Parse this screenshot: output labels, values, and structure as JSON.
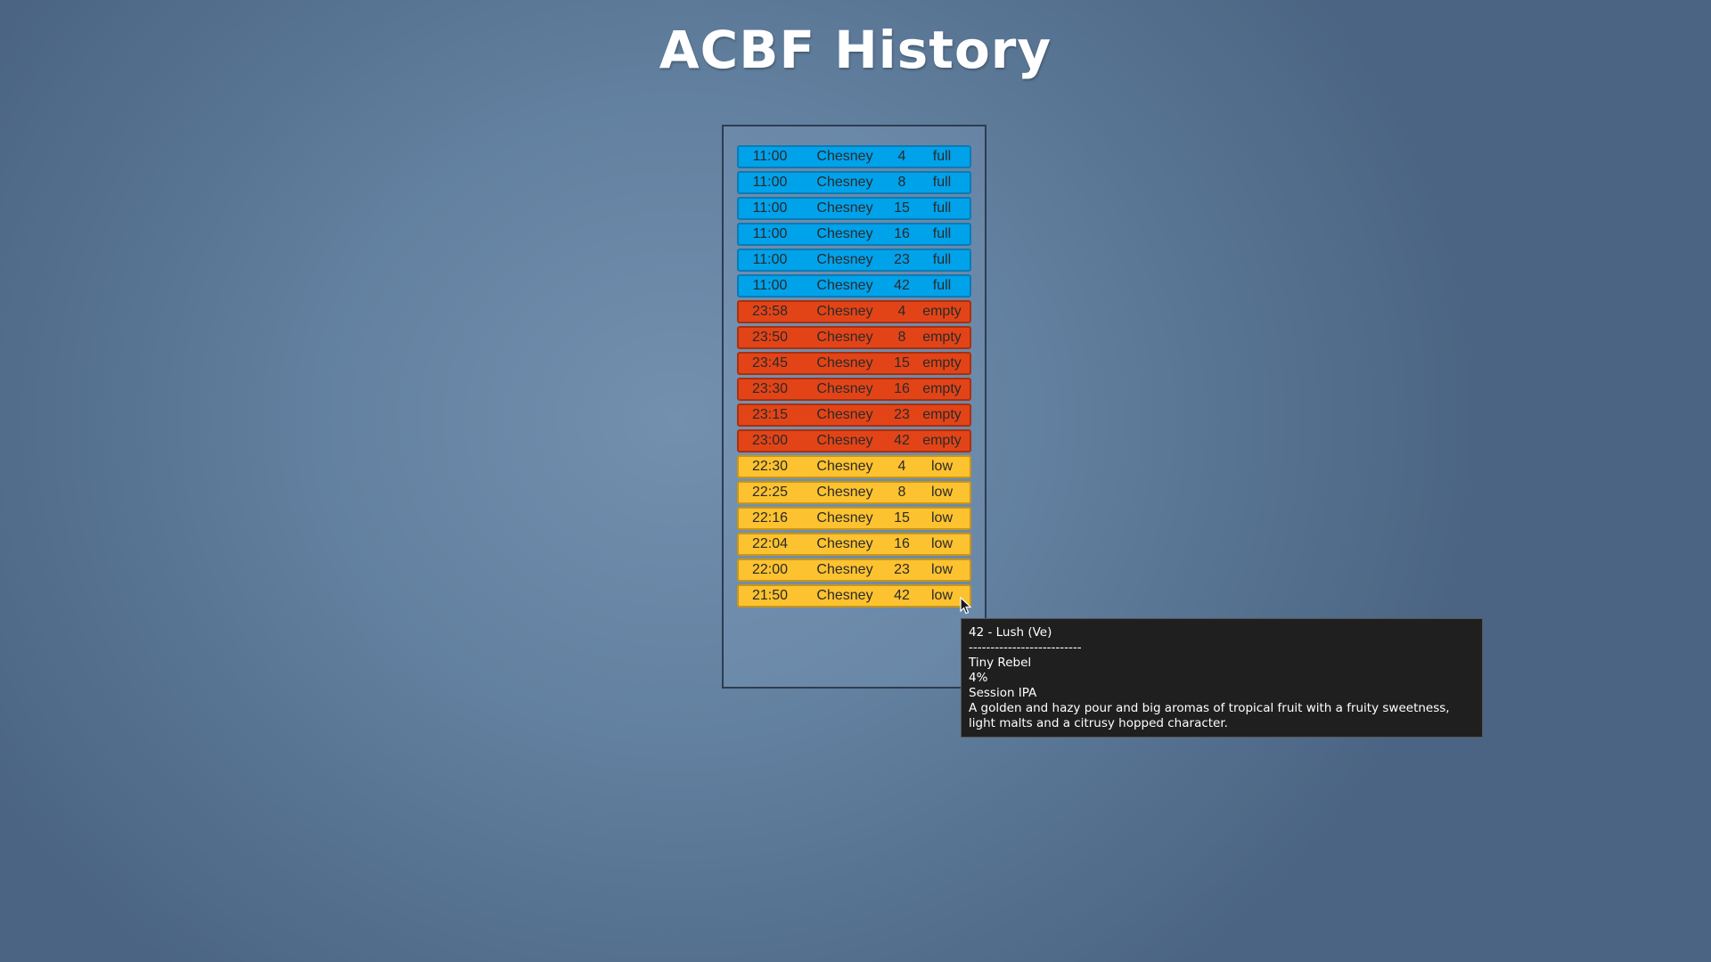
{
  "title": "ACBF History",
  "colors": {
    "full": "#00a2ea",
    "empty": "#e34417",
    "low": "#fdc22f"
  },
  "rows": [
    {
      "time": "11:00",
      "venue": "Chesney",
      "num": "4",
      "status": "full"
    },
    {
      "time": "11:00",
      "venue": "Chesney",
      "num": "8",
      "status": "full"
    },
    {
      "time": "11:00",
      "venue": "Chesney",
      "num": "15",
      "status": "full"
    },
    {
      "time": "11:00",
      "venue": "Chesney",
      "num": "16",
      "status": "full"
    },
    {
      "time": "11:00",
      "venue": "Chesney",
      "num": "23",
      "status": "full"
    },
    {
      "time": "11:00",
      "venue": "Chesney",
      "num": "42",
      "status": "full"
    },
    {
      "time": "23:58",
      "venue": "Chesney",
      "num": "4",
      "status": "empty"
    },
    {
      "time": "23:50",
      "venue": "Chesney",
      "num": "8",
      "status": "empty"
    },
    {
      "time": "23:45",
      "venue": "Chesney",
      "num": "15",
      "status": "empty"
    },
    {
      "time": "23:30",
      "venue": "Chesney",
      "num": "16",
      "status": "empty"
    },
    {
      "time": "23:15",
      "venue": "Chesney",
      "num": "23",
      "status": "empty"
    },
    {
      "time": "23:00",
      "venue": "Chesney",
      "num": "42",
      "status": "empty"
    },
    {
      "time": "22:30",
      "venue": "Chesney",
      "num": "4",
      "status": "low"
    },
    {
      "time": "22:25",
      "venue": "Chesney",
      "num": "8",
      "status": "low"
    },
    {
      "time": "22:16",
      "venue": "Chesney",
      "num": "15",
      "status": "low"
    },
    {
      "time": "22:04",
      "venue": "Chesney",
      "num": "16",
      "status": "low"
    },
    {
      "time": "22:00",
      "venue": "Chesney",
      "num": "23",
      "status": "low"
    },
    {
      "time": "21:50",
      "venue": "Chesney",
      "num": "42",
      "status": "low"
    }
  ],
  "tooltip": {
    "heading": "42 - Lush (Ve)",
    "divider": "--------------------------",
    "brewery": "Tiny Rebel",
    "abv": "4%",
    "style": "Session IPA",
    "description": "A golden and hazy pour and big aromas of tropical fruit with a fruity sweetness, light malts and a citrusy hopped character."
  },
  "cursor_icon": "arrow-cursor-icon"
}
